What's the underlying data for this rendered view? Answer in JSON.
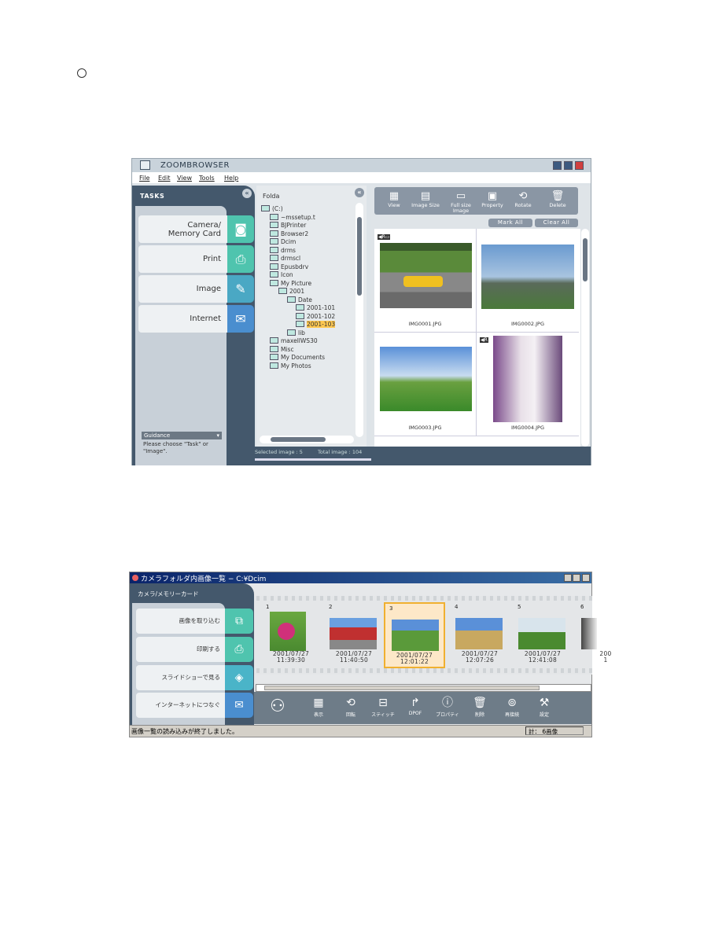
{
  "page": {
    "bullet": "○"
  },
  "zoombrowser": {
    "title": "ZOOMBROWSER",
    "menu": [
      "File",
      "Edit",
      "View",
      "Tools",
      "Help"
    ],
    "tasks_header": "TASKS",
    "tasks": [
      {
        "label": "Camera/ Memory Card",
        "icon": "camera-icon",
        "color": "#4fc4ae"
      },
      {
        "label": "Print",
        "icon": "print-icon",
        "color": "#4fc4ae"
      },
      {
        "label": "Image",
        "icon": "image-edit-icon",
        "color": "#4aa8c4"
      },
      {
        "label": "Internet",
        "icon": "globe-mail-icon",
        "color": "#4a8ecf"
      }
    ],
    "guidance_label": "Guidance",
    "guidance_text": "Please choose \"Task\" or \"Image\".",
    "folder_header": "Folda",
    "tree": [
      {
        "label": "(C:)",
        "level": 0
      },
      {
        "label": "~mssetup.t",
        "level": 1
      },
      {
        "label": "BJPrinter",
        "level": 1
      },
      {
        "label": "Browser2",
        "level": 1
      },
      {
        "label": "Dcim",
        "level": 1
      },
      {
        "label": "drms",
        "level": 1
      },
      {
        "label": "drmscl",
        "level": 1
      },
      {
        "label": "Epusbdrv",
        "level": 1
      },
      {
        "label": "Icon",
        "level": 1
      },
      {
        "label": "My Picture",
        "level": 1
      },
      {
        "label": "2001",
        "level": 2
      },
      {
        "label": "Date",
        "level": 3
      },
      {
        "label": "2001-101",
        "level": 4
      },
      {
        "label": "2001-102",
        "level": 4
      },
      {
        "label": "2001-103",
        "level": 4,
        "selected": true
      },
      {
        "label": "lib",
        "level": 3
      },
      {
        "label": "maxellWS30",
        "level": 1
      },
      {
        "label": "Misc",
        "level": 1
      },
      {
        "label": "My Documents",
        "level": 1
      },
      {
        "label": "My Photos",
        "level": 1
      }
    ],
    "toolbar": [
      {
        "label": "View",
        "icon": "view-icon"
      },
      {
        "label": "Image Size",
        "icon": "image-size-icon"
      },
      {
        "label": "Full size Image",
        "icon": "full-size-icon"
      },
      {
        "label": "Property",
        "icon": "property-icon"
      },
      {
        "label": "Rotate",
        "icon": "rotate-icon"
      },
      {
        "label": "Delete",
        "icon": "delete-icon"
      }
    ],
    "mark_all": "Mark All",
    "clear_all": "Clear All",
    "images": [
      "IMG0001.JPG",
      "IMG0002.JPG",
      "IMG0003.JPG",
      "IMG0004.JPG"
    ],
    "status_selected": "Selected image   : 5",
    "status_total": "Total image     : 104"
  },
  "jp": {
    "title": "カメラフォルダ内画像一覧 − C:¥Dcim",
    "panel_header": "カメラ/メモリーカード",
    "tasks": [
      {
        "label": "画像を取り込む",
        "color": "#4fc4ae"
      },
      {
        "label": "印刷する",
        "color": "#4fc4ae"
      },
      {
        "label": "スライドショーで見る",
        "color": "#4ab4c8"
      },
      {
        "label": "インターネットにつなぐ",
        "color": "#4a8ecf"
      }
    ],
    "thumbs": [
      {
        "n": "1",
        "d": "2001/07/27",
        "t": "11:39:30"
      },
      {
        "n": "2",
        "d": "2001/07/27",
        "t": "11:40:50"
      },
      {
        "n": "3",
        "d": "2001/07/27",
        "t": "12:01:22",
        "selected": true
      },
      {
        "n": "4",
        "d": "2001/07/27",
        "t": "12:07:26"
      },
      {
        "n": "5",
        "d": "2001/07/27",
        "t": "12:41:08"
      },
      {
        "n": "6",
        "d": "200",
        "t": "1"
      }
    ],
    "toolbar": [
      "表示",
      "回転",
      "スティッチ",
      "DPOF",
      "プロパティ",
      "削除",
      "再接続",
      "設定"
    ],
    "status": "画像一覧の読み込みが終了しました。",
    "count": "計： 6画像",
    "accent": "#f0b030"
  }
}
